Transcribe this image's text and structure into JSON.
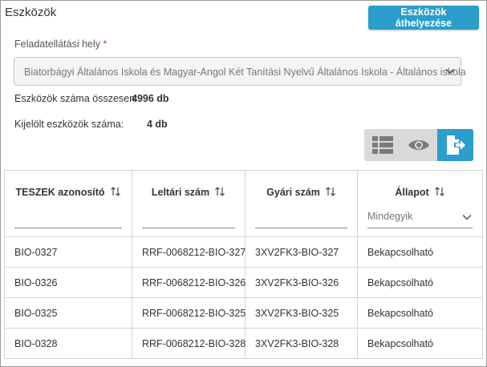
{
  "page": {
    "title": "Eszközök",
    "move_button_label": "Eszközök áthelyezése"
  },
  "location": {
    "label": "Feladatellátási hely",
    "required_mark": "*",
    "selected_value": "Biatorbágyi Általános Iskola és Magyar-Angol Két Tanítási Nyelvű Általános Iskola - Általános iskola"
  },
  "stats": {
    "total_label": "Eszközök száma összesen:",
    "total_value": "4996 db",
    "selected_label": "Kijelölt eszközök száma:",
    "selected_value": "4 db"
  },
  "view_buttons": [
    {
      "icon": "list-icon",
      "active": false
    },
    {
      "icon": "eye-icon",
      "active": false
    },
    {
      "icon": "export-icon",
      "active": true
    }
  ],
  "table": {
    "columns": [
      {
        "label": "TESZEK azonosító"
      },
      {
        "label": "Leltári szám"
      },
      {
        "label": "Gyári szám"
      },
      {
        "label": "Állapot",
        "filter_value": "Mindegyik"
      }
    ],
    "rows": [
      [
        "BIO-0327",
        "RRF-0068212-BIO-327",
        "3XV2FK3-BIO-327",
        "Bekapcsolható"
      ],
      [
        "BIO-0326",
        "RRF-0068212-BIO-326",
        "3XV2FK3-BIO-326",
        "Bekapcsolható"
      ],
      [
        "BIO-0325",
        "RRF-0068212-BIO-325",
        "3XV2FK3-BIO-325",
        "Bekapcsolható"
      ],
      [
        "BIO-0328",
        "RRF-0068212-BIO-328",
        "3XV2FK3-BIO-328",
        "Bekapcsolható"
      ]
    ]
  },
  "colors": {
    "accent": "#2b9ecb",
    "required": "#d32f2f",
    "view_group_bg": "#d9d9d9"
  }
}
